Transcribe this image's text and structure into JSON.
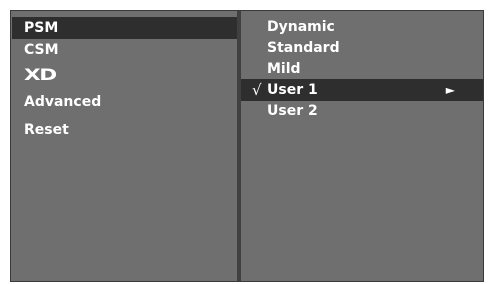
{
  "left_menu": {
    "items": [
      {
        "label": "PSM",
        "selected": true
      },
      {
        "label": "CSM",
        "selected": false
      },
      {
        "label": "XD",
        "selected": false,
        "icon": "xd-logo"
      },
      {
        "label": "Advanced",
        "selected": false
      },
      {
        "label": "Reset",
        "selected": false
      }
    ]
  },
  "right_menu": {
    "items": [
      {
        "label": "Dynamic",
        "selected": false
      },
      {
        "label": "Standard",
        "selected": false
      },
      {
        "label": "Mild",
        "selected": false
      },
      {
        "label": "User 1",
        "selected": true,
        "check": "√",
        "arrow": "►"
      },
      {
        "label": "User 2",
        "selected": false
      }
    ]
  },
  "colors": {
    "panel_bg": "#6f6f6f",
    "highlight_bg": "#2e2e2e",
    "divider": "#404040",
    "text": "#ffffff"
  }
}
